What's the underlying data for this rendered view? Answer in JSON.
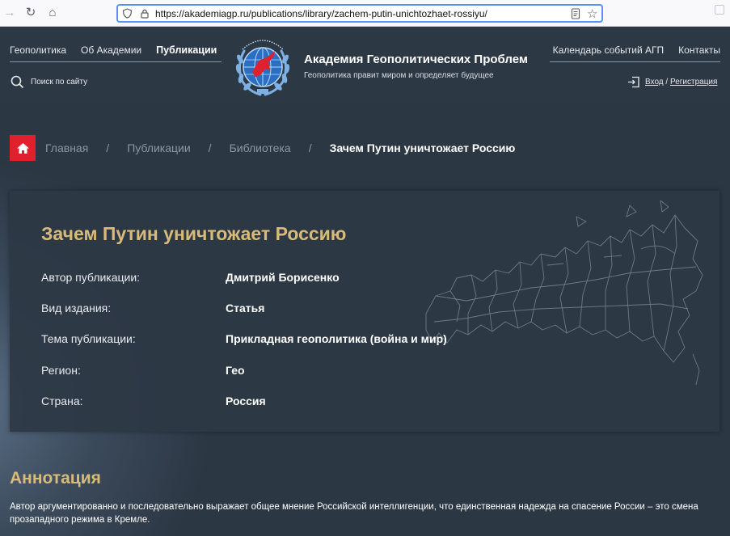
{
  "browser": {
    "url": "https://akademiagp.ru/publications/library/zachem-putin-unichtozhaet-rossiyu/"
  },
  "header": {
    "nav_left": [
      "Геополитика",
      "Об Академии",
      "Публикации"
    ],
    "nav_right": [
      "Календарь событий АГП",
      "Контакты"
    ],
    "search_label": "Поиск по сайту",
    "org_name": "Академия Геополитических Проблем",
    "org_slogan": "Геополитика правит миром и определяет будущее",
    "login_label": "Вход",
    "login_sep": "/",
    "register_label": "Регистрация"
  },
  "breadcrumb": {
    "items": [
      "Главная",
      "Публикации",
      "Библиотека"
    ],
    "separator": "/",
    "current": "Зачем Путин уничтожает Россию"
  },
  "publication": {
    "title": "Зачем Путин уничтожает Россию",
    "meta": [
      {
        "label": "Автор публикации:",
        "value": "Дмитрий Борисенко"
      },
      {
        "label": "Вид издания:",
        "value": "Статья"
      },
      {
        "label": "Тема публикации:",
        "value": "Прикладная геополитика (война и мир)"
      },
      {
        "label": "Регион:",
        "value": "Гео"
      },
      {
        "label": "Страна:",
        "value": "Россия"
      }
    ]
  },
  "annotation": {
    "title": "Аннотация",
    "text": "Автор аргументированно и последовательно выражает общее мнение Российской интеллигенции, что единственная надежда на спасение России – это смена прозападного режима в Кремле."
  },
  "colors": {
    "accent_gold": "#d9bb79",
    "home_red": "#e0202c",
    "background": "#2c3744"
  }
}
